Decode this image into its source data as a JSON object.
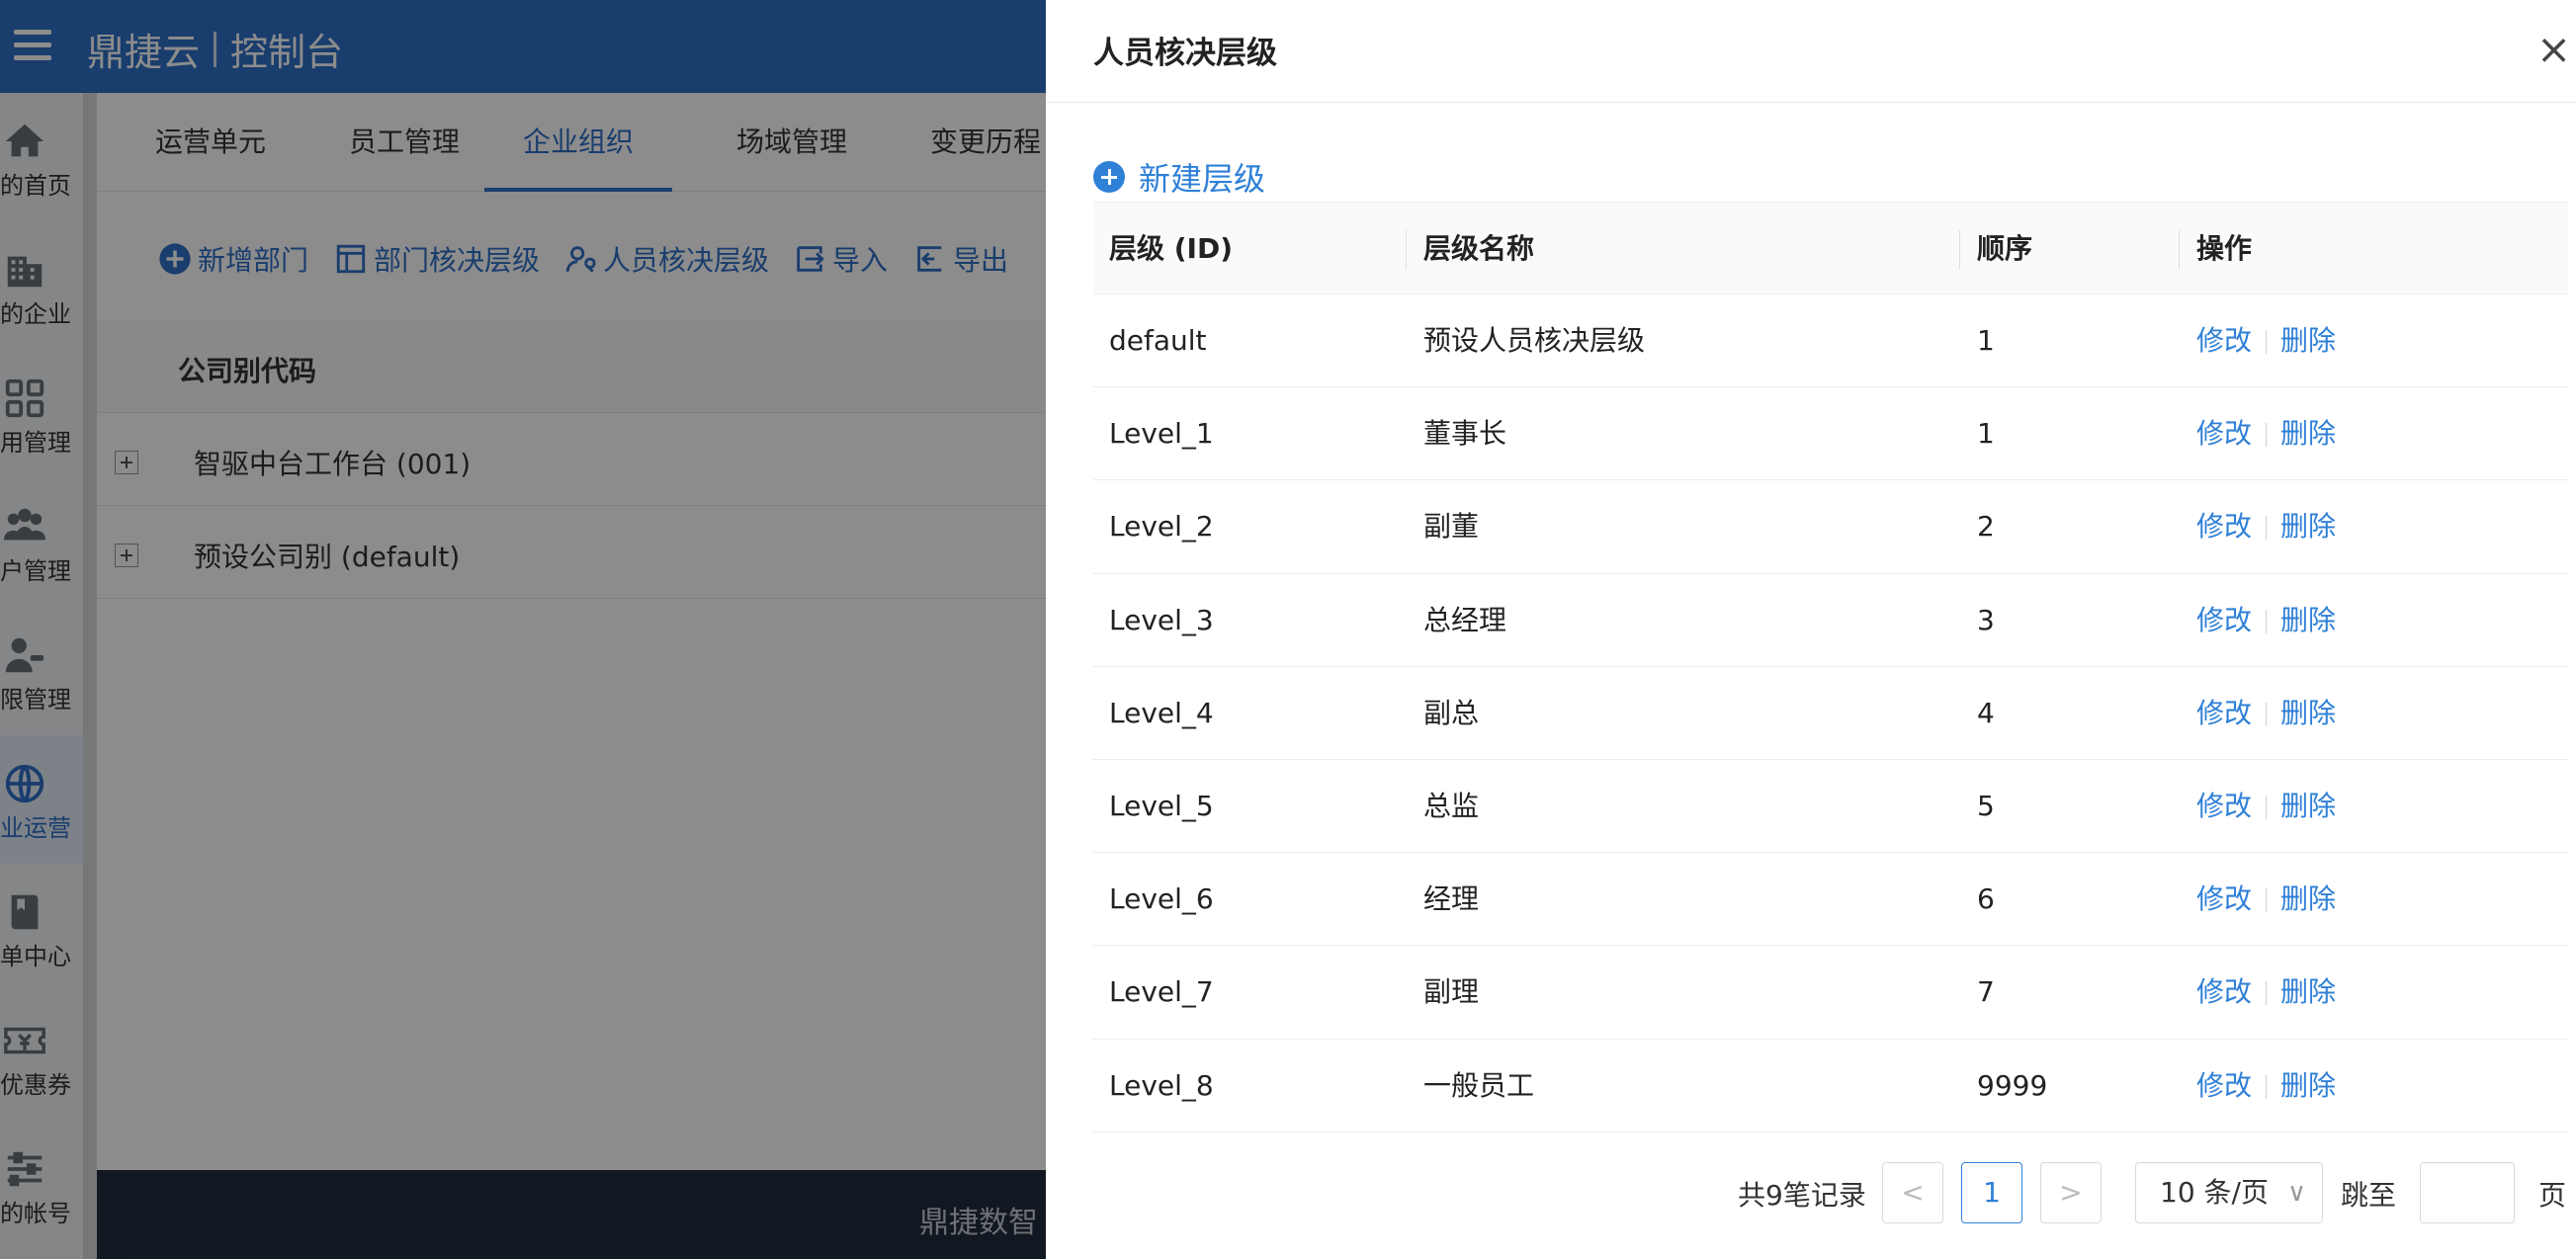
{
  "app": {
    "brand": "鼎捷云",
    "console": "控制台"
  },
  "sidebar": {
    "items": [
      {
        "label": "的首页",
        "icon": "home-icon"
      },
      {
        "label": "的企业",
        "icon": "building-icon"
      },
      {
        "label": "用管理",
        "icon": "apps-grid-icon"
      },
      {
        "label": "户管理",
        "icon": "users-icon"
      },
      {
        "label": "限管理",
        "icon": "user-key-icon"
      },
      {
        "label": "业运营",
        "icon": "globe-icon",
        "active": true
      },
      {
        "label": "单中心",
        "icon": "book-icon"
      },
      {
        "label": "优惠券",
        "icon": "coupon-icon"
      },
      {
        "label": "的帐号",
        "icon": "sliders-icon"
      }
    ]
  },
  "tabs": [
    {
      "label": "运营单元"
    },
    {
      "label": "员工管理"
    },
    {
      "label": "企业组织",
      "active": true
    },
    {
      "label": "场域管理"
    },
    {
      "label": "变更历程"
    }
  ],
  "toolbar": {
    "add_dept": "新增部门",
    "dept_level": "部门核决层级",
    "person_level": "人员核决层级",
    "import": "导入",
    "export": "导出"
  },
  "bgtable": {
    "header": "公司别代码",
    "rows": [
      "智驱中台工作台 (001)",
      "预设公司别 (default)"
    ]
  },
  "footer": {
    "text": "鼎捷数智"
  },
  "drawer": {
    "title": "人员核决层级",
    "close": "×",
    "create_label": "新建层级",
    "columns": {
      "id": "层级 (ID)",
      "name": "层级名称",
      "order": "顺序",
      "actions": "操作"
    },
    "edit_label": "修改",
    "delete_label": "删除",
    "rows": [
      {
        "id": "default",
        "name": "预设人员核决层级",
        "order": "1"
      },
      {
        "id": "Level_1",
        "name": "董事长",
        "order": "1"
      },
      {
        "id": "Level_2",
        "name": "副董",
        "order": "2"
      },
      {
        "id": "Level_3",
        "name": "总经理",
        "order": "3"
      },
      {
        "id": "Level_4",
        "name": "副总",
        "order": "4"
      },
      {
        "id": "Level_5",
        "name": "总监",
        "order": "5"
      },
      {
        "id": "Level_6",
        "name": "经理",
        "order": "6"
      },
      {
        "id": "Level_7",
        "name": "副理",
        "order": "7"
      },
      {
        "id": "Level_8",
        "name": "一般员工",
        "order": "9999"
      }
    ],
    "pagination": {
      "total_text": "共9笔记录",
      "prev": "<",
      "current": "1",
      "next": ">",
      "page_size": "10 条/页",
      "page_size_chevron": "∨",
      "jump_label": "跳至",
      "page_label": "页"
    }
  }
}
